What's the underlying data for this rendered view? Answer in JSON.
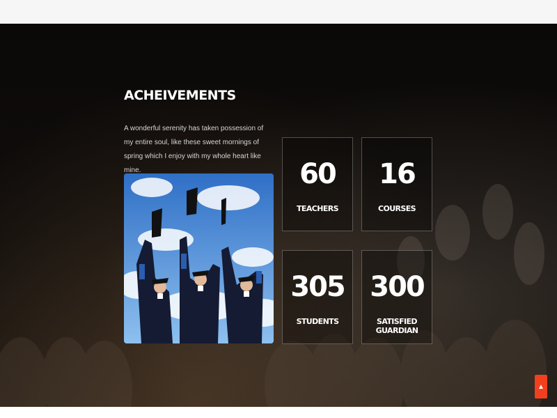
{
  "achievements": {
    "title": "ACHEIVEMENTS",
    "description": "A wonderful serenity has taken possession of my entire soul, like these sweet mornings of spring which I enjoy with my whole heart like mine.",
    "stats": [
      {
        "value": "60",
        "label": "TEACHERS"
      },
      {
        "value": "16",
        "label": "COURSES"
      },
      {
        "value": "305",
        "label": "STUDENTS"
      },
      {
        "value": "300",
        "label": "SATISFIED GUARDIAN"
      }
    ]
  },
  "scroll_top": {
    "icon": "chevron-up-icon",
    "color": "#f2401e"
  },
  "colors": {
    "background": "#0b0908",
    "accent": "#f2401e",
    "text": "#ffffff"
  }
}
